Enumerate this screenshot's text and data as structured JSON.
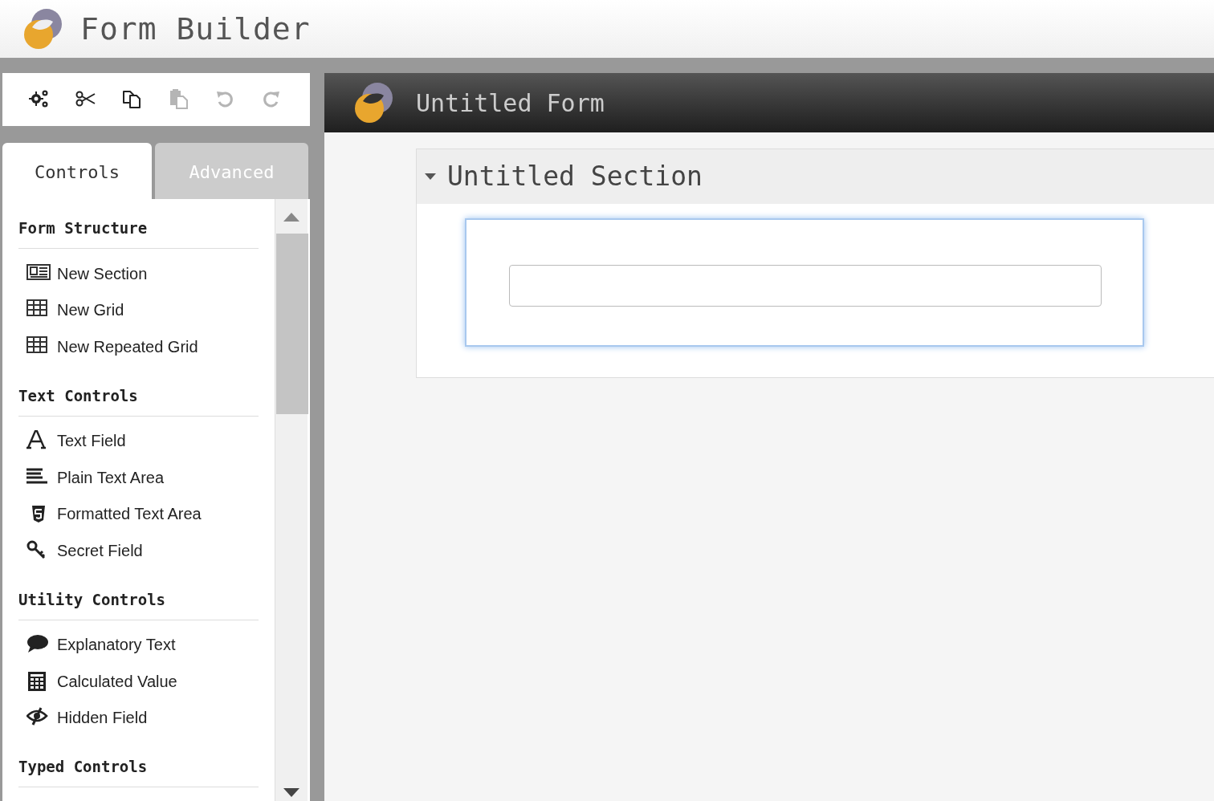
{
  "app": {
    "title": "Form Builder"
  },
  "toolbar": [
    {
      "kind": "settings",
      "disabled": false
    },
    {
      "kind": "cut",
      "disabled": false
    },
    {
      "kind": "copy",
      "disabled": false
    },
    {
      "kind": "paste",
      "disabled": true
    },
    {
      "kind": "undo",
      "disabled": true
    },
    {
      "kind": "redo",
      "disabled": true
    }
  ],
  "tabs": [
    {
      "label": "Controls",
      "selected": true
    },
    {
      "label": "Advanced",
      "selected": false
    }
  ],
  "palette": [
    {
      "heading": "Form Structure",
      "items": [
        "New Section",
        "New Grid",
        "New Repeated Grid"
      ]
    },
    {
      "heading": "Text Controls",
      "items": [
        "Text Field",
        "Plain Text Area",
        "Formatted Text Area",
        "Secret Field"
      ]
    },
    {
      "heading": "Utility Controls",
      "items": [
        "Explanatory Text",
        "Calculated Value",
        "Hidden Field"
      ]
    },
    {
      "heading": "Typed Controls"
    }
  ],
  "form": {
    "title": "Untitled Form",
    "section": {
      "title": "Untitled Section",
      "expanded": true
    }
  }
}
